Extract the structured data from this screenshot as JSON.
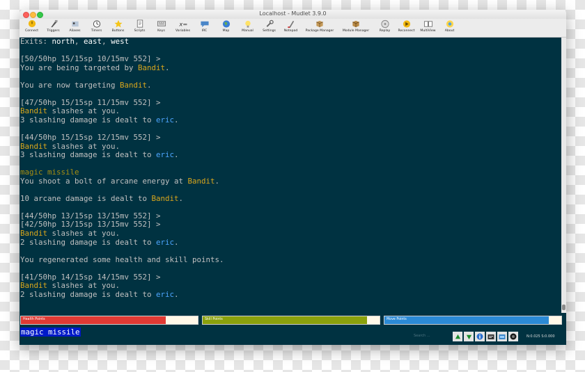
{
  "window": {
    "title": "Localhost - Mudlet 3.9.0"
  },
  "toolbar": {
    "items": [
      {
        "label": "Connect",
        "icon": "connect-icon"
      },
      {
        "label": "Triggers",
        "icon": "triggers-icon"
      },
      {
        "label": "Aliases",
        "icon": "aliases-icon"
      },
      {
        "label": "Timers",
        "icon": "timers-icon"
      },
      {
        "label": "Buttons",
        "icon": "buttons-icon"
      },
      {
        "label": "Scripts",
        "icon": "scripts-icon"
      },
      {
        "label": "Keys",
        "icon": "keys-icon"
      },
      {
        "label": "Variables",
        "icon": "variables-icon"
      },
      {
        "label": "IRC",
        "icon": "irc-icon"
      },
      {
        "label": "Map",
        "icon": "map-icon"
      },
      {
        "label": "Manual",
        "icon": "manual-icon"
      },
      {
        "label": "Settings",
        "icon": "settings-icon"
      },
      {
        "label": "Notepad",
        "icon": "notepad-icon"
      },
      {
        "label": "Package Manager",
        "icon": "package-manager-icon"
      },
      {
        "label": "Module Manager",
        "icon": "module-manager-icon"
      },
      {
        "label": "Replay",
        "icon": "replay-icon"
      },
      {
        "label": "Reconnect",
        "icon": "reconnect-icon"
      },
      {
        "label": "MultiView",
        "icon": "multiview-icon"
      },
      {
        "label": "About",
        "icon": "about-icon"
      }
    ]
  },
  "colors": {
    "background": "#003241",
    "text": "#c0c0c0",
    "bright": "#ffffff",
    "orange": "#d9a61c",
    "blue": "#4da6ff",
    "spell": "#a68d12",
    "health": "#e03a34",
    "skill": "#8aa10c",
    "move": "#2b8ad6",
    "command_highlight": "#0019c8"
  },
  "console": {
    "lines": [
      [
        {
          "t": "Exits: ",
          "c": "text"
        },
        {
          "t": "north",
          "c": "bright"
        },
        {
          "t": ", ",
          "c": "text"
        },
        {
          "t": "east",
          "c": "bright"
        },
        {
          "t": ", ",
          "c": "text"
        },
        {
          "t": "west",
          "c": "bright"
        }
      ],
      [],
      [
        {
          "t": "[50/50hp 15/15sp 10/15mv 552] >",
          "c": "text"
        }
      ],
      [
        {
          "t": "You are being targeted by ",
          "c": "text"
        },
        {
          "t": "Bandit",
          "c": "orange"
        },
        {
          "t": ".",
          "c": "text"
        }
      ],
      [],
      [
        {
          "t": "You are now targeting ",
          "c": "text"
        },
        {
          "t": "Bandit",
          "c": "orange"
        },
        {
          "t": ".",
          "c": "text"
        }
      ],
      [],
      [
        {
          "t": "[47/50hp 15/15sp 11/15mv 552] >",
          "c": "text"
        }
      ],
      [
        {
          "t": "Bandit",
          "c": "orange"
        },
        {
          "t": " slashes at you.",
          "c": "text"
        }
      ],
      [
        {
          "t": "3 slashing damage is dealt to ",
          "c": "text"
        },
        {
          "t": "eric",
          "c": "blue"
        },
        {
          "t": ".",
          "c": "text"
        }
      ],
      [],
      [
        {
          "t": "[44/50hp 15/15sp 12/15mv 552] >",
          "c": "text"
        }
      ],
      [
        {
          "t": "Bandit",
          "c": "orange"
        },
        {
          "t": " slashes at you.",
          "c": "text"
        }
      ],
      [
        {
          "t": "3 slashing damage is dealt to ",
          "c": "text"
        },
        {
          "t": "eric",
          "c": "blue"
        },
        {
          "t": ".",
          "c": "text"
        }
      ],
      [],
      [
        {
          "t": "magic missile",
          "c": "spell"
        }
      ],
      [
        {
          "t": "You shoot a bolt of arcane energy at ",
          "c": "text"
        },
        {
          "t": "Bandit",
          "c": "orange"
        },
        {
          "t": ".",
          "c": "text"
        }
      ],
      [],
      [
        {
          "t": "10 arcane damage is dealt to ",
          "c": "text"
        },
        {
          "t": "Bandit",
          "c": "orange"
        },
        {
          "t": ".",
          "c": "text"
        }
      ],
      [],
      [
        {
          "t": "[44/50hp 13/15sp 13/15mv 552] >",
          "c": "text"
        }
      ],
      [
        {
          "t": "[42/50hp 13/15sp 13/15mv 552] >",
          "c": "text"
        }
      ],
      [
        {
          "t": "Bandit",
          "c": "orange"
        },
        {
          "t": " slashes at you.",
          "c": "text"
        }
      ],
      [
        {
          "t": "2 slashing damage is dealt to ",
          "c": "text"
        },
        {
          "t": "eric",
          "c": "blue"
        },
        {
          "t": ".",
          "c": "text"
        }
      ],
      [],
      [
        {
          "t": "You regenerated some health and skill points.",
          "c": "text"
        }
      ],
      [],
      [
        {
          "t": "[41/50hp 14/15sp 14/15mv 552] >",
          "c": "text"
        }
      ],
      [
        {
          "t": "Bandit",
          "c": "orange"
        },
        {
          "t": " slashes at you.",
          "c": "text"
        }
      ],
      [
        {
          "t": "2 slashing damage is dealt to ",
          "c": "text"
        },
        {
          "t": "eric",
          "c": "blue"
        },
        {
          "t": ".",
          "c": "text"
        }
      ]
    ]
  },
  "gauges": {
    "health": {
      "label": "Health Points",
      "fill": 0.82
    },
    "skill": {
      "label": "Skill Points",
      "fill": 0.93
    },
    "move": {
      "label": "Move Points",
      "fill": 0.93
    }
  },
  "command": {
    "value": "magic missile"
  },
  "search": {
    "placeholder": "Search ..."
  },
  "statusbar": {
    "buttons": [
      {
        "icon": "scroll-up-icon"
      },
      {
        "icon": "scroll-down-icon"
      },
      {
        "icon": "info-icon"
      },
      {
        "icon": "timestamp-icon"
      },
      {
        "icon": "replay-record-icon"
      },
      {
        "icon": "emergency-stop-icon"
      }
    ],
    "network": "N:0.025 S:0.000"
  }
}
